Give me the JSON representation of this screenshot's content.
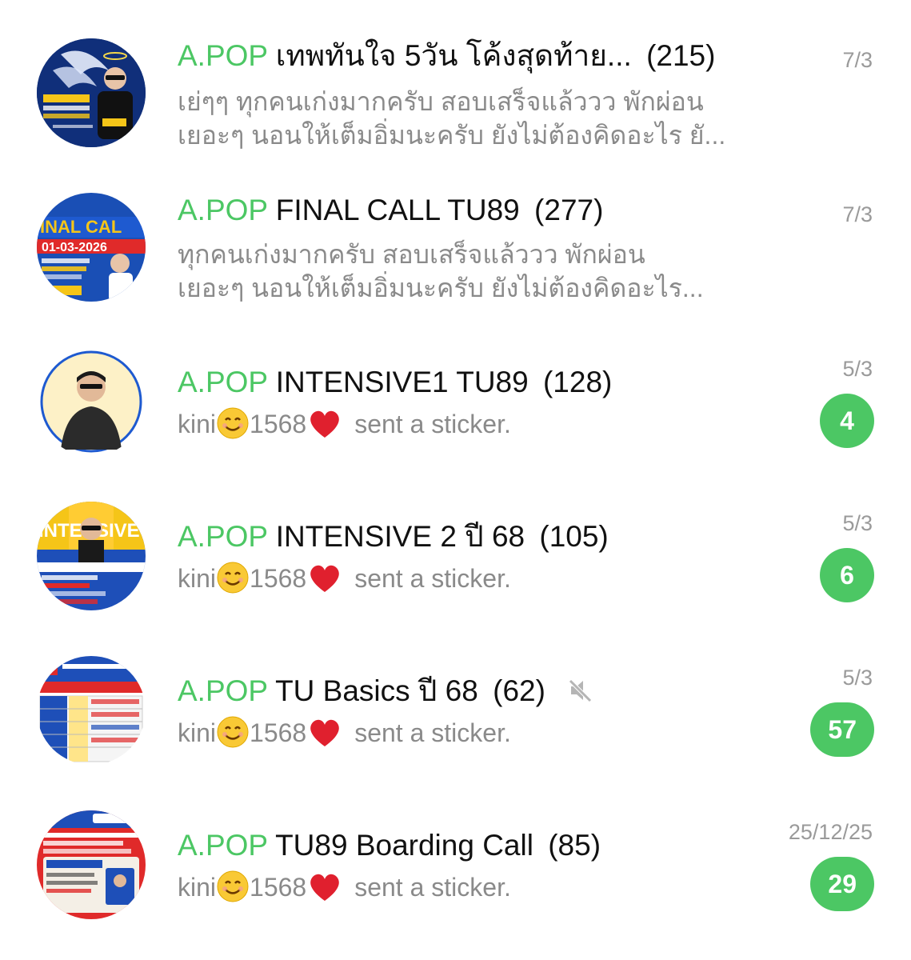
{
  "colors": {
    "brand": "#4cc764",
    "badge": "#4cc764",
    "secondary_text": "#8a8a8a",
    "timestamp": "#9a9a9a"
  },
  "chats": [
    {
      "brand": "A.POP",
      "name": "เทพทันใจ 5วัน โค้งสุดท้าย...",
      "count": "(215)",
      "time": "7/3",
      "preview_lines": [
        "เย่ๆๆ ทุกคนเก่งมากครับ สอบเสร็จแล้ววว พักผ่อน",
        "เยอะๆ นอนให้เต็มอิ่มนะครับ ยังไม่ต้องคิดอะไร ยั..."
      ],
      "avatar_icon": "poster-thumbnail-icon"
    },
    {
      "brand": "A.POP",
      "name": "FINAL CALL TU89",
      "count": "(277)",
      "time": "7/3",
      "preview_lines": [
        "ทุกคนเก่งมากครับ สอบเสร็จแล้ววว พักผ่อน",
        "เยอะๆ นอนให้เต็มอิ่มนะครับ ยังไม่ต้องคิดอะไร..."
      ],
      "avatar_icon": "poster-thumbnail-icon"
    },
    {
      "brand": "A.POP",
      "name": "INTENSIVE1 TU89",
      "count": "(128)",
      "time": "5/3",
      "sender_name": "kini",
      "sender_number": "1568",
      "message": "sent a sticker.",
      "unread": "4",
      "avatar_icon": "profile-photo-icon"
    },
    {
      "brand": "A.POP",
      "name": "INTENSIVE 2 ปี 68",
      "count": "(105)",
      "time": "5/3",
      "sender_name": "kini",
      "sender_number": "1568",
      "message": "sent a sticker.",
      "unread": "6",
      "avatar_icon": "poster-thumbnail-icon"
    },
    {
      "brand": "A.POP",
      "name": "TU Basics ปี 68",
      "count": "(62)",
      "time": "5/3",
      "sender_name": "kini",
      "sender_number": "1568",
      "message": "sent a sticker.",
      "unread": "57",
      "muted": true,
      "avatar_icon": "poster-thumbnail-icon"
    },
    {
      "brand": "A.POP",
      "name": "TU89 Boarding Call",
      "count": "(85)",
      "time": "25/12/25",
      "sender_name": "kini",
      "sender_number": "1568",
      "message": "sent a sticker.",
      "unread": "29",
      "avatar_icon": "poster-thumbnail-icon"
    }
  ]
}
